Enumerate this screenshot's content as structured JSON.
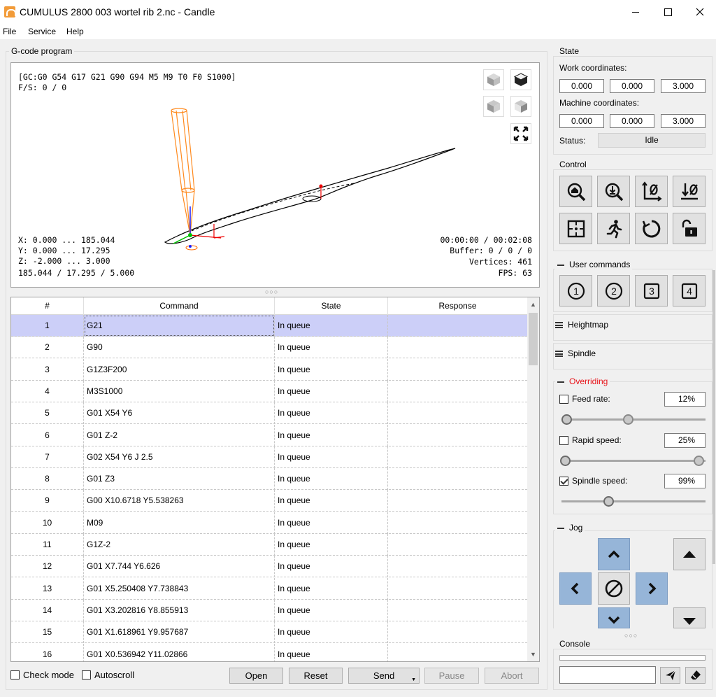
{
  "window": {
    "title": "CUMULUS 2800 003 wortel rib 2.nc - Candle"
  },
  "menu": [
    "File",
    "Service",
    "Help"
  ],
  "gcode": {
    "group_title": "G-code program",
    "status_line": "[GC:G0 G54 G17 G21 G90 G94 M5 M9 T0 F0 S1000]",
    "fs_line": "F/S: 0 / 0",
    "x_range": "X: 0.000 ... 185.044",
    "y_range": "Y: 0.000 ... 17.295",
    "z_range": "Z: -2.000 ... 3.000",
    "size": "185.044 / 17.295 / 5.000",
    "time": "00:00:00 / 00:02:08",
    "buffer": "Buffer: 0 / 0 / 0",
    "vertices": "Vertices: 461",
    "fps": "FPS: 63",
    "view_buttons": [
      "cube-isometric-icon",
      "cube-top-icon",
      "cube-front-icon",
      "cube-left-icon",
      "fit-view-icon"
    ]
  },
  "table": {
    "headers": [
      "#",
      "Command",
      "State",
      "Response"
    ],
    "rows": [
      {
        "num": "1",
        "cmd": "G21",
        "state": "In queue",
        "resp": ""
      },
      {
        "num": "2",
        "cmd": "G90",
        "state": "In queue",
        "resp": ""
      },
      {
        "num": "3",
        "cmd": "G1Z3F200",
        "state": "In queue",
        "resp": ""
      },
      {
        "num": "4",
        "cmd": "M3S1000",
        "state": "In queue",
        "resp": ""
      },
      {
        "num": "5",
        "cmd": "G01 X54 Y6",
        "state": "In queue",
        "resp": ""
      },
      {
        "num": "6",
        "cmd": "G01 Z-2",
        "state": "In queue",
        "resp": ""
      },
      {
        "num": "7",
        "cmd": "G02  X54 Y6 J 2.5",
        "state": "In queue",
        "resp": ""
      },
      {
        "num": "8",
        "cmd": "G01 Z3",
        "state": "In queue",
        "resp": ""
      },
      {
        "num": "9",
        "cmd": "G00 X10.6718 Y5.538263",
        "state": "In queue",
        "resp": ""
      },
      {
        "num": "10",
        "cmd": "M09",
        "state": "In queue",
        "resp": ""
      },
      {
        "num": "11",
        "cmd": "G1Z-2",
        "state": "In queue",
        "resp": ""
      },
      {
        "num": "12",
        "cmd": "G01 X7.744 Y6.626",
        "state": "In queue",
        "resp": ""
      },
      {
        "num": "13",
        "cmd": "G01 X5.250408 Y7.738843",
        "state": "In queue",
        "resp": ""
      },
      {
        "num": "14",
        "cmd": "G01 X3.202816 Y8.855913",
        "state": "In queue",
        "resp": ""
      },
      {
        "num": "15",
        "cmd": "G01 X1.618961 Y9.957687",
        "state": "In queue",
        "resp": ""
      },
      {
        "num": "16",
        "cmd": "G01 X0.536942 Y11.02866",
        "state": "In queue",
        "resp": ""
      }
    ]
  },
  "bottom": {
    "check_mode": "Check mode",
    "autoscroll": "Autoscroll",
    "open": "Open",
    "reset": "Reset",
    "send": "Send",
    "pause": "Pause",
    "abort": "Abort"
  },
  "state": {
    "title": "State",
    "work_label": "Work coordinates:",
    "work": [
      "0.000",
      "0.000",
      "3.000"
    ],
    "machine_label": "Machine coordinates:",
    "machine": [
      "0.000",
      "0.000",
      "3.000"
    ],
    "status_label": "Status:",
    "status": "Idle"
  },
  "control": {
    "title": "Control"
  },
  "user_commands": {
    "title": "User commands",
    "buttons": [
      "1",
      "2",
      "3",
      "4"
    ]
  },
  "heightmap": {
    "title": "Heightmap"
  },
  "spindle": {
    "title": "Spindle"
  },
  "overriding": {
    "title": "Overriding",
    "title_color": "#e8141a",
    "feed_label": "Feed rate:",
    "feed_value": "12%",
    "feed_checked": false,
    "rapid_label": "Rapid speed:",
    "rapid_value": "25%",
    "rapid_checked": false,
    "spindle_label": "Spindle speed:",
    "spindle_value": "99%",
    "spindle_checked": true
  },
  "jog": {
    "title": "Jog"
  },
  "console": {
    "title": "Console",
    "input_value": ""
  }
}
